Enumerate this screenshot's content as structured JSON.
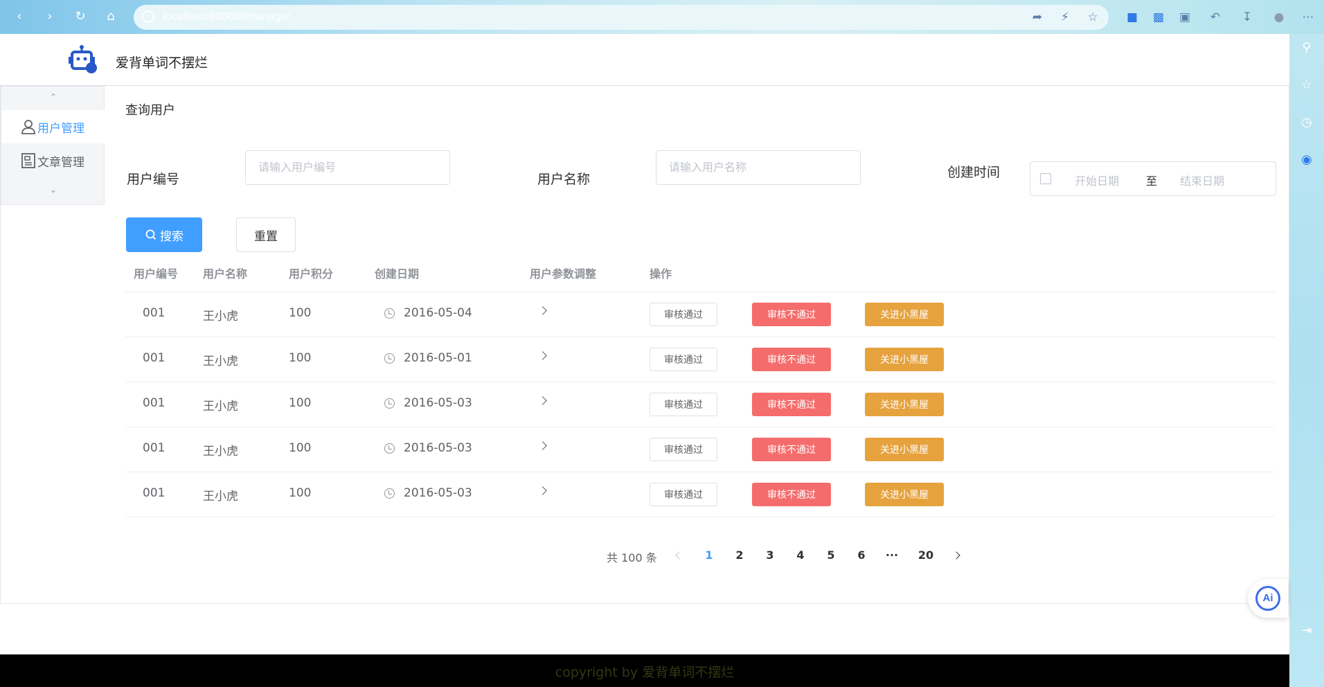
{
  "browser": {
    "url": "localhost:8080/#/manager"
  },
  "app": {
    "title": "爱背单词不摆烂"
  },
  "menu": {
    "items": [
      {
        "label": "用户管理",
        "active": true
      },
      {
        "label": "文章管理",
        "active": false
      }
    ]
  },
  "query": {
    "section_title": "查询用户",
    "user_id_label": "用户编号",
    "user_id_placeholder": "请输入用户编号",
    "user_name_label": "用户名称",
    "user_name_placeholder": "请输入用户名称",
    "created_label": "创建时间",
    "start_placeholder": "开始日期",
    "range_sep": "至",
    "end_placeholder": "结束日期",
    "search_label": "搜索",
    "reset_label": "重置"
  },
  "table": {
    "headers": [
      "用户编号",
      "用户名称",
      "用户积分",
      "创建日期",
      "用户参数调整",
      "操作"
    ],
    "rows": [
      {
        "id": "001",
        "name": "王小虎",
        "points": "100",
        "date": "2016-05-04"
      },
      {
        "id": "001",
        "name": "王小虎",
        "points": "100",
        "date": "2016-05-01"
      },
      {
        "id": "001",
        "name": "王小虎",
        "points": "100",
        "date": "2016-05-03"
      },
      {
        "id": "001",
        "name": "王小虎",
        "points": "100",
        "date": "2016-05-03"
      },
      {
        "id": "001",
        "name": "王小虎",
        "points": "100",
        "date": "2016-05-03"
      }
    ],
    "actions": {
      "pass": "审核通过",
      "fail": "审核不通过",
      "blacklist": "关进小黑屋"
    }
  },
  "pagination": {
    "total_text": "共 100 条",
    "pages": [
      "1",
      "2",
      "3",
      "4",
      "5",
      "6",
      "···",
      "20"
    ],
    "current": "1"
  },
  "footer": {
    "text": "copyright by 爱背单词不摆烂"
  },
  "colors": {
    "primary": "#409eff",
    "danger": "#f56c6c",
    "warning": "#e6a23c"
  }
}
